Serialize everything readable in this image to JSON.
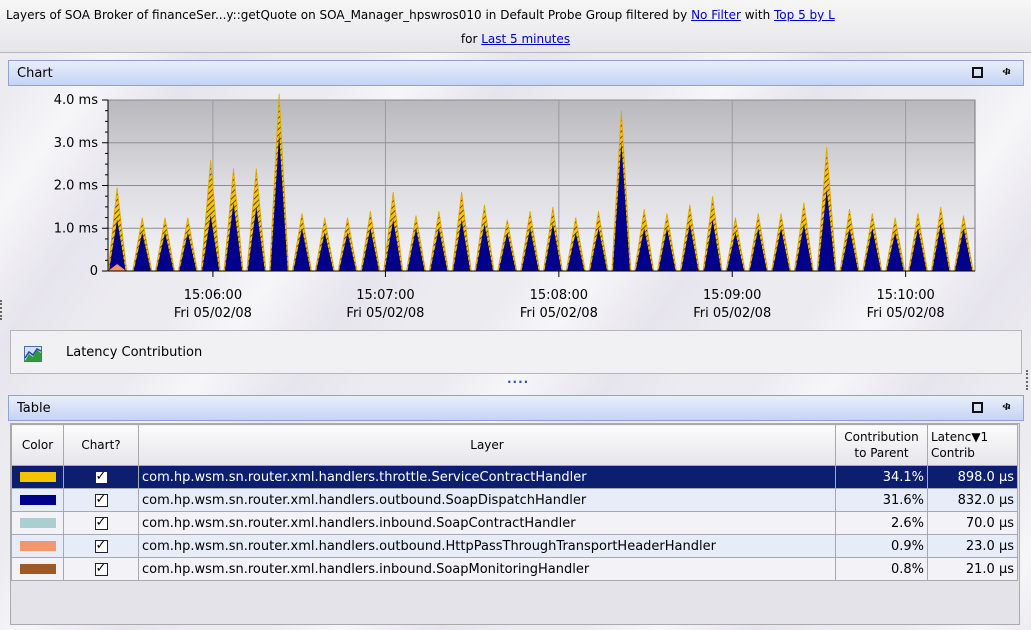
{
  "title_bar": {
    "prefix": "Layers of SOA Broker of financeSer...y::getQuote on SOA_Manager_hpswros010 in Default Probe Group filtered by ",
    "filter_link": "No Filter",
    "middle": " with ",
    "top_link": "Top 5 by L",
    "for_text": "for ",
    "time_link": "Last 5 minutes"
  },
  "chart_panel": {
    "title": "Chart",
    "legend_label": "Latency Contribution",
    "splitter": "...."
  },
  "chart_data": {
    "type": "area",
    "stacked": true,
    "y_ticks": [
      "0",
      "1.0 ms",
      "2.0 ms",
      "3.0 ms",
      "4.0 ms"
    ],
    "ylim": [
      0,
      4.0
    ],
    "x_ticks": [
      {
        "time": "15:06:00",
        "date": "Fri 05/02/08"
      },
      {
        "time": "15:07:00",
        "date": "Fri 05/02/08"
      },
      {
        "time": "15:08:00",
        "date": "Fri 05/02/08"
      },
      {
        "time": "15:09:00",
        "date": "Fri 05/02/08"
      },
      {
        "time": "15:10:00",
        "date": "Fri 05/02/08"
      }
    ],
    "grid": true,
    "series": [
      {
        "name": "com.hp.wsm.sn.router.xml.handlers.outbound.SoapDispatchHandler",
        "color": "#00008b",
        "values": [
          1.2,
          0.9,
          0.9,
          0.9,
          1.3,
          1.6,
          1.5,
          3.2,
          1.0,
          0.9,
          0.9,
          1.0,
          1.2,
          1.0,
          1.0,
          1.2,
          1.1,
          0.9,
          1.0,
          1.1,
          0.9,
          1.0,
          3.0,
          1.0,
          1.0,
          1.1,
          1.2,
          0.9,
          1.0,
          1.0,
          1.1,
          1.9,
          1.0,
          1.0,
          0.9,
          1.0,
          1.1,
          1.0
        ]
      },
      {
        "name": "com.hp.wsm.sn.router.xml.handlers.throttle.ServiceContractHandler",
        "color": "#f5c400",
        "values": [
          0.75,
          0.35,
          0.35,
          0.35,
          1.3,
          0.8,
          0.9,
          0.95,
          0.35,
          0.35,
          0.35,
          0.4,
          0.65,
          0.3,
          0.4,
          0.65,
          0.45,
          0.3,
          0.4,
          0.4,
          0.35,
          0.4,
          0.75,
          0.45,
          0.35,
          0.45,
          0.55,
          0.35,
          0.35,
          0.35,
          0.5,
          1.0,
          0.45,
          0.35,
          0.35,
          0.35,
          0.4,
          0.3
        ]
      }
    ],
    "x_positions": [
      0.4,
      1.5,
      2.5,
      3.5,
      4.5,
      5.5,
      6.5,
      7.5,
      8.5,
      9.5,
      10.5,
      11.5,
      12.5,
      13.5,
      14.5,
      15.5,
      16.5,
      17.5,
      18.5,
      19.5,
      20.5,
      21.5,
      22.5,
      23.5,
      24.5,
      25.5,
      26.5,
      27.5,
      28.5,
      29.5,
      30.5,
      31.5,
      32.5,
      33.5,
      34.5,
      35.5,
      36.5,
      37.5
    ]
  },
  "table_panel": {
    "title": "Table",
    "headers": {
      "color": "Color",
      "chart": "Chart?",
      "layer": "Layer",
      "contribution_line1": "Contribution",
      "contribution_line2": "to Parent",
      "latency_line1": "Latenc▼1",
      "latency_line2": "Contrib"
    },
    "rows": [
      {
        "color": "#f5c400",
        "layer": "com.hp.wsm.sn.router.xml.handlers.throttle.ServiceContractHandler",
        "contribution": "34.1%",
        "latency": "898.0 µs",
        "checked": true
      },
      {
        "color": "#00008b",
        "layer": "com.hp.wsm.sn.router.xml.handlers.outbound.SoapDispatchHandler",
        "contribution": "31.6%",
        "latency": "832.0 µs",
        "checked": true
      },
      {
        "color": "#a9cfd0",
        "layer": "com.hp.wsm.sn.router.xml.handlers.inbound.SoapContractHandler",
        "contribution": "2.6%",
        "latency": "70.0 µs",
        "checked": true
      },
      {
        "color": "#f5956a",
        "layer": "com.hp.wsm.sn.router.xml.handlers.outbound.HttpPassThroughTransportHeaderHandler",
        "contribution": "0.9%",
        "latency": "23.0 µs",
        "checked": true
      },
      {
        "color": "#9c5a2a",
        "layer": "com.hp.wsm.sn.router.xml.handlers.inbound.SoapMonitoringHandler",
        "contribution": "0.8%",
        "latency": "21.0 µs",
        "checked": true
      }
    ],
    "checkbox_glyph": "✓"
  },
  "icons": {
    "maximize": "maximize-icon",
    "pin": "pin-icon",
    "pin_glyph": "ቁ",
    "legend": "chart-legend-icon"
  }
}
